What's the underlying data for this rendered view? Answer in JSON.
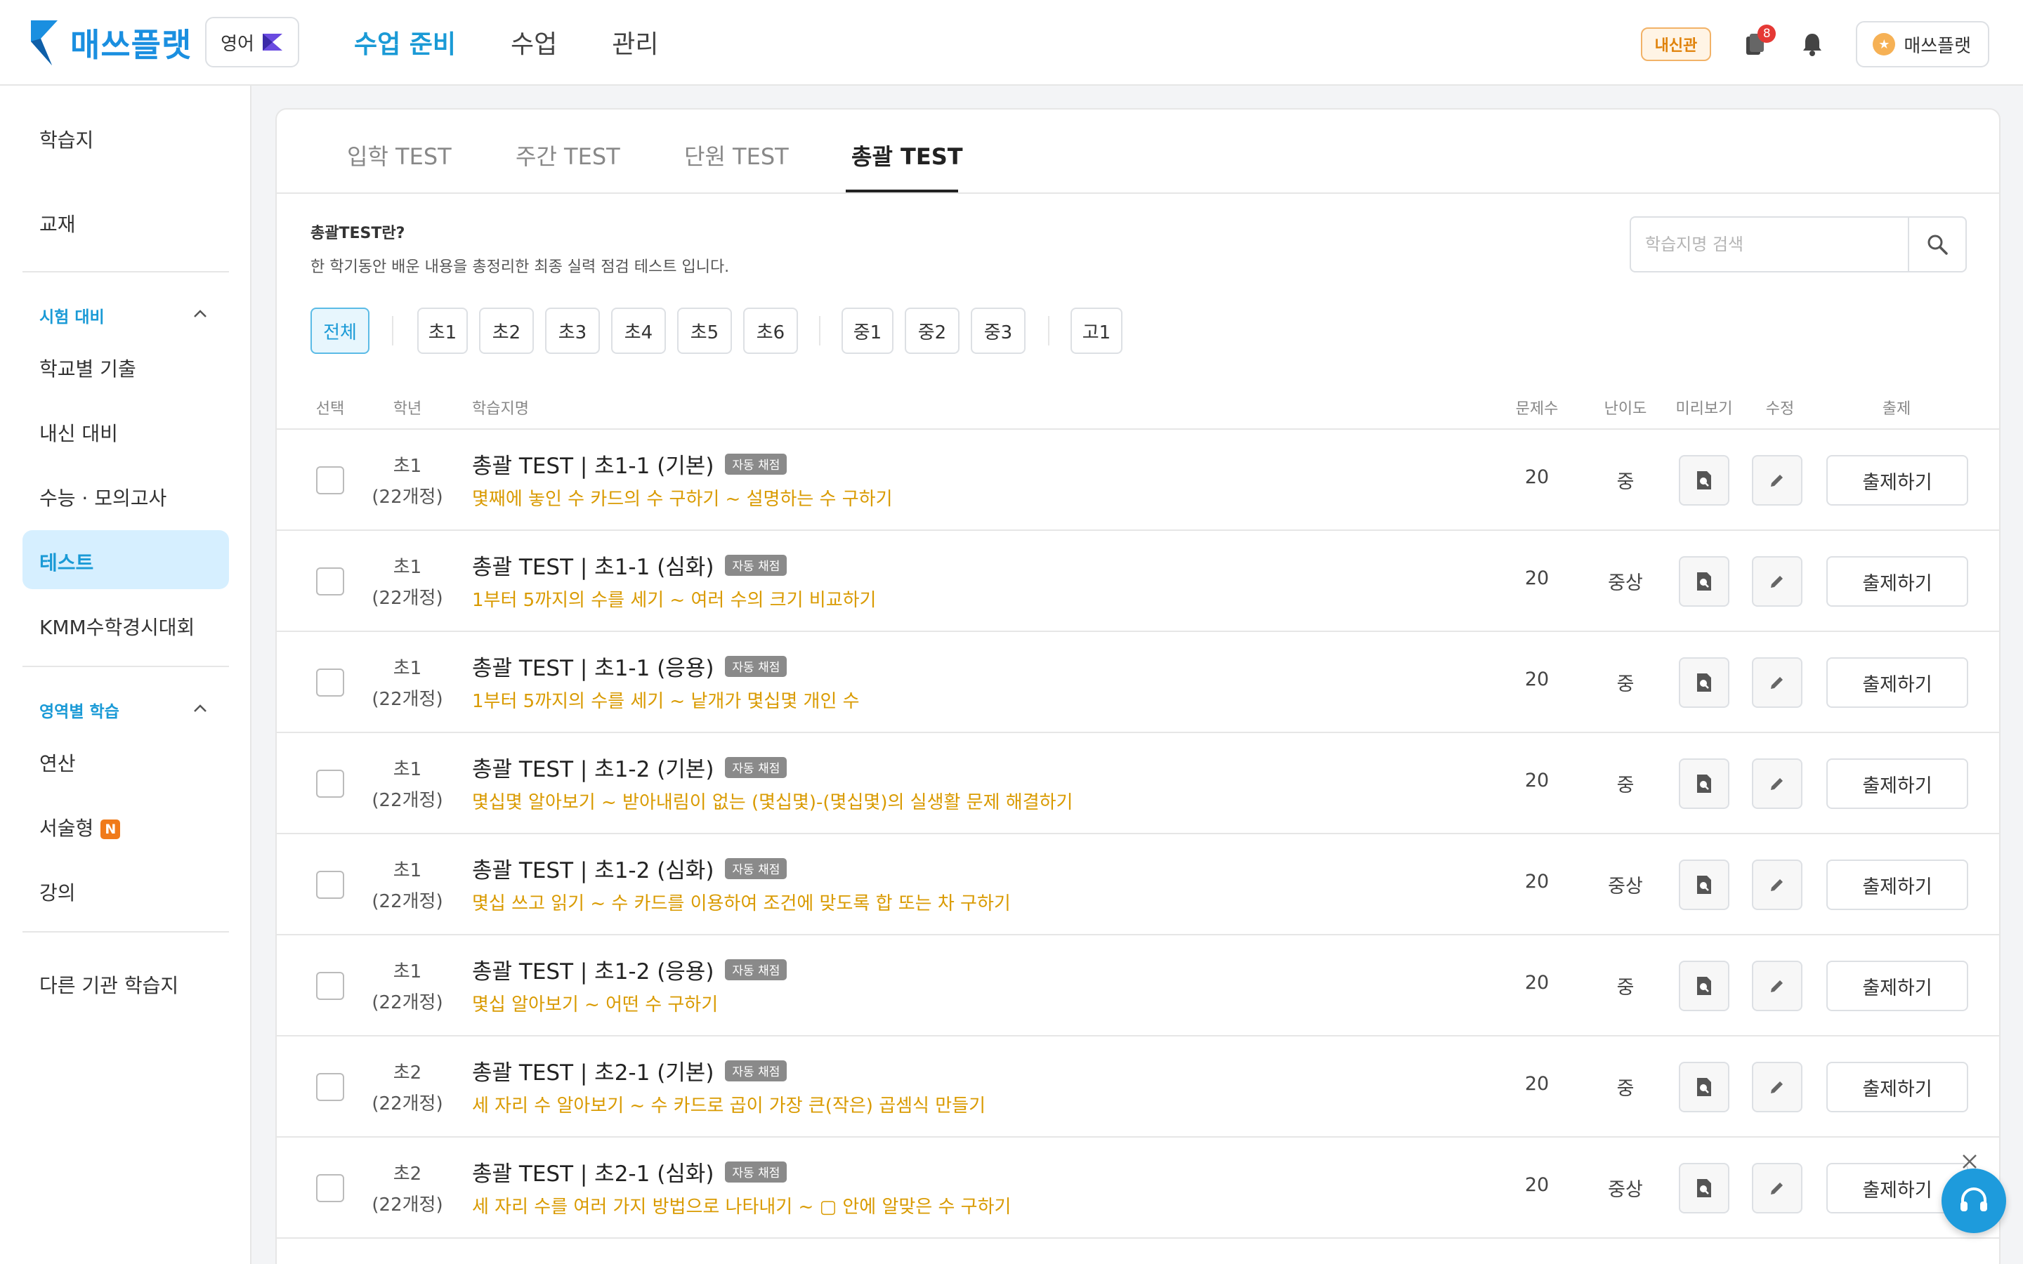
{
  "header": {
    "logo_text": "매쓰플랫",
    "subject_label": "영어",
    "nav": [
      "수업 준비",
      "수업",
      "관리"
    ],
    "naesin_label": "내신관",
    "notification_count": "8",
    "user_name": "매쓰플랫"
  },
  "sidebar": {
    "item_worksheet": "학습지",
    "item_textbook": "교재",
    "section_exam": "시험 대비",
    "item_school_past": "학교별 기출",
    "item_naesin": "내신 대비",
    "item_suneung": "수능 · 모의고사",
    "item_test": "테스트",
    "item_kmm": "KMM수학경시대회",
    "section_area": "영역별 학습",
    "item_calc": "연산",
    "item_essay": "서술형",
    "essay_badge": "N",
    "item_lecture": "강의",
    "item_other": "다른 기관 학습지"
  },
  "tabs": [
    "입학 TEST",
    "주간 TEST",
    "단원 TEST",
    "총괄 TEST"
  ],
  "description": {
    "title": "총괄TEST란?",
    "text": "한 학기동안 배운 내용을 총정리한 최종 실력 점검 테스트 입니다."
  },
  "search": {
    "placeholder": "학습지명 검색"
  },
  "filters": [
    "전체",
    "초1",
    "초2",
    "초3",
    "초4",
    "초5",
    "초6",
    "중1",
    "중2",
    "중3",
    "고1"
  ],
  "columns": {
    "select": "선택",
    "grade": "학년",
    "name": "학습지명",
    "count": "문제수",
    "difficulty": "난이도",
    "preview": "미리보기",
    "edit": "수정",
    "issue": "출제"
  },
  "auto_label": "자동 채점",
  "issue_label": "출제하기",
  "rows": [
    {
      "grade": "초1",
      "curriculum": "(22개정)",
      "title": "총괄 TEST | 초1-1 (기본)",
      "subtitle": "몇째에 놓인 수 카드의 수 구하기 ~ 설명하는 수 구하기",
      "count": "20",
      "difficulty": "중"
    },
    {
      "grade": "초1",
      "curriculum": "(22개정)",
      "title": "총괄 TEST | 초1-1 (심화)",
      "subtitle": "1부터 5까지의 수를 세기 ~ 여러 수의 크기 비교하기",
      "count": "20",
      "difficulty": "중상"
    },
    {
      "grade": "초1",
      "curriculum": "(22개정)",
      "title": "총괄 TEST | 초1-1 (응용)",
      "subtitle": "1부터 5까지의 수를 세기 ~ 낱개가 몇십몇 개인 수",
      "count": "20",
      "difficulty": "중"
    },
    {
      "grade": "초1",
      "curriculum": "(22개정)",
      "title": "총괄 TEST | 초1-2 (기본)",
      "subtitle": "몇십몇 알아보기 ~ 받아내림이 없는 (몇십몇)-(몇십몇)의 실생활 문제 해결하기",
      "count": "20",
      "difficulty": "중"
    },
    {
      "grade": "초1",
      "curriculum": "(22개정)",
      "title": "총괄 TEST | 초1-2 (심화)",
      "subtitle": "몇십 쓰고 읽기 ~ 수 카드를 이용하여 조건에 맞도록 합 또는 차 구하기",
      "count": "20",
      "difficulty": "중상"
    },
    {
      "grade": "초1",
      "curriculum": "(22개정)",
      "title": "총괄 TEST | 초1-2 (응용)",
      "subtitle": "몇십 알아보기 ~ 어떤 수 구하기",
      "count": "20",
      "difficulty": "중"
    },
    {
      "grade": "초2",
      "curriculum": "(22개정)",
      "title": "총괄 TEST | 초2-1 (기본)",
      "subtitle": "세 자리 수 알아보기 ~ 수 카드로 곱이 가장 큰(작은) 곱셈식 만들기",
      "count": "20",
      "difficulty": "중"
    },
    {
      "grade": "초2",
      "curriculum": "(22개정)",
      "title": "총괄 TEST | 초2-1 (심화)",
      "subtitle": "세 자리 수를 여러 가지 방법으로 나타내기 ~ ▢ 안에 알맞은 수 구하기",
      "count": "20",
      "difficulty": "중상"
    }
  ],
  "colors": {
    "accent": "#1a9ad6",
    "subtitle": "#d99a00",
    "active_bg": "#d6efff"
  }
}
